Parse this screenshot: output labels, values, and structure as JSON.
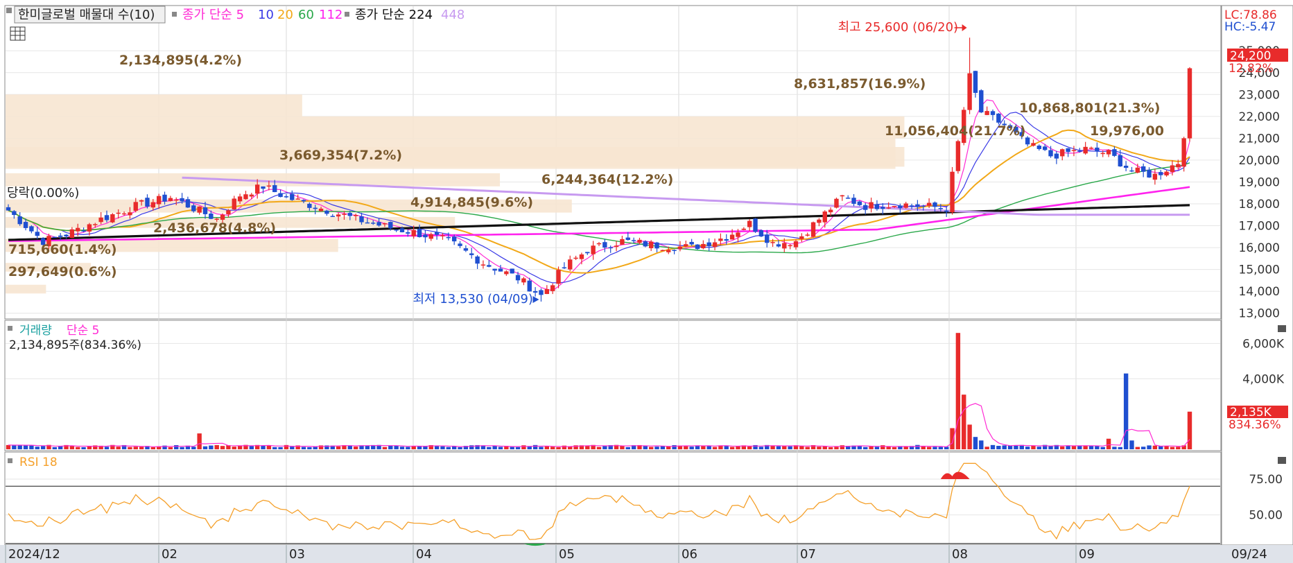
{
  "header": {
    "stock_label": "한미글로벌 매물대 수(10)",
    "ma_label": "종가 단순 5",
    "ma_periods": [
      "10",
      "20",
      "60",
      "112"
    ],
    "ma2_label": "종가 단순 224",
    "ma2_period": "448"
  },
  "price_panel": {
    "lc": "LC:78.86",
    "hc": "HC:-5.47",
    "current_price": "24,200",
    "current_change": "12.82%",
    "high_annotation": "최고 25,600 (06/20)",
    "low_annotation": "최저 13,530 (04/09)",
    "change_label": "당락(0.00%)",
    "y_ticks": [
      "25,000",
      "24,000",
      "23,000",
      "22,000",
      "21,000",
      "20,000",
      "19,000",
      "18,000",
      "17,000",
      "16,000",
      "15,000",
      "14,000",
      "13,000"
    ],
    "volume_profile": [
      {
        "label": "2,134,895(4.2%)",
        "low": 22000,
        "high": 23000,
        "fraction": 0.33
      },
      {
        "label": "8,631,857(16.9%)",
        "low": 21000,
        "high": 22000,
        "fraction": 1.0
      },
      {
        "label": "10,868,801(21.3%)",
        "low": 20000,
        "high": 21000,
        "fraction": 0.99
      },
      {
        "label": "11,056,404(21.7%)",
        "low": 19700,
        "high": 20600,
        "fraction": 1.0
      },
      {
        "label": "19,976,00",
        "low": 19600,
        "high": 20300,
        "fraction": 0.99
      },
      {
        "label": "6,244,364(12.2%)",
        "low": 17600,
        "high": 18200,
        "fraction": 0.63
      },
      {
        "label": "3,669,354(7.2%)",
        "low": 18800,
        "high": 19400,
        "fraction": 0.55
      },
      {
        "label": "4,914,845(9.6%)",
        "low": 16900,
        "high": 17400,
        "fraction": 0.5
      },
      {
        "label": "2,436,678(4.8%)",
        "low": 15800,
        "high": 16400,
        "fraction": 0.37
      },
      {
        "label": "715,660(1.4%)",
        "low": 14900,
        "high": 15300,
        "fraction": 0.095
      },
      {
        "label": "297,649(0.6%)",
        "low": 13900,
        "high": 14300,
        "fraction": 0.045
      }
    ]
  },
  "volume_panel": {
    "title": "거래량",
    "ma_label": "단순 5",
    "current": "2,134,895주(834.36%)",
    "y_ticks": [
      "6,000K",
      "4,000K"
    ],
    "current_tag": "2,135K",
    "current_pct": "834.36%"
  },
  "rsi_panel": {
    "title": "RSI 18",
    "y_ticks": [
      "75.00",
      "50.00"
    ]
  },
  "x_axis": {
    "labels": [
      "2024/12",
      "02",
      "03",
      "04",
      "05",
      "06",
      "07",
      "08",
      "09"
    ],
    "date_tag": "09/24"
  },
  "colors": {
    "up": "#e82b2b",
    "down": "#1f4fd0",
    "ma5": "#ff2ad4",
    "ma10": "#3a3ae6",
    "ma20": "#f2a818",
    "ma60": "#2aa84a",
    "ma112": "#ff22ee",
    "ma224": "#111111",
    "ma448": "#c79af0",
    "profile": "#f7e6d2",
    "rsi": "#f5a02a"
  },
  "chart_data": {
    "type": "candlestick",
    "title": "한미글로벌",
    "period": [
      "2024-12",
      "2025-09-24"
    ],
    "price_range": [
      12800,
      25800
    ],
    "high": {
      "value": 25600,
      "date": "06/20"
    },
    "low": {
      "value": 13530,
      "date": "04/09"
    },
    "last_close": 24200,
    "anchors": [
      {
        "x": 0.0,
        "close": 17700
      },
      {
        "x": 0.04,
        "close": 16300
      },
      {
        "x": 0.08,
        "close": 17500
      },
      {
        "x": 0.12,
        "close": 18400
      },
      {
        "x": 0.135,
        "close": 17300
      },
      {
        "x": 0.16,
        "close": 18300
      },
      {
        "x": 0.2,
        "close": 18600
      },
      {
        "x": 0.22,
        "close": 18200
      },
      {
        "x": 0.26,
        "close": 16800
      },
      {
        "x": 0.3,
        "close": 16900
      },
      {
        "x": 0.34,
        "close": 15100
      },
      {
        "x": 0.378,
        "close": 13700
      },
      {
        "x": 0.4,
        "close": 15100
      },
      {
        "x": 0.44,
        "close": 16200
      },
      {
        "x": 0.48,
        "close": 15900
      },
      {
        "x": 0.52,
        "close": 16100
      },
      {
        "x": 0.53,
        "close": 16600
      },
      {
        "x": 0.545,
        "close": 17300
      },
      {
        "x": 0.57,
        "close": 15800
      },
      {
        "x": 0.6,
        "close": 18300
      },
      {
        "x": 0.645,
        "close": 17300
      },
      {
        "x": 0.62,
        "close": 17800
      },
      {
        "x": 0.61,
        "close": 18400
      },
      {
        "x": 0.615,
        "close": 18100
      }
    ],
    "volume_range": [
      0,
      7000
    ],
    "rsi_range": [
      30,
      90
    ],
    "rsi_levels": [
      70,
      30
    ]
  }
}
